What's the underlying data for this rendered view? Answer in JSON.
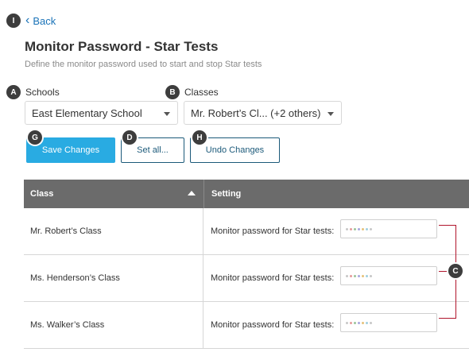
{
  "back": {
    "label": "Back"
  },
  "page": {
    "title": "Monitor Password - Star Tests",
    "subtitle": "Define the monitor password used to start and stop Star tests"
  },
  "markers": {
    "back": "I",
    "schools": "A",
    "classes": "B",
    "save": "G",
    "set_all": "D",
    "undo": "H",
    "passwords": "C"
  },
  "filters": {
    "schools_label": "Schools",
    "schools_value": "East Elementary School",
    "classes_label": "Classes",
    "classes_value": "Mr. Robert’s Cl... (+2 others)"
  },
  "buttons": {
    "save": "Save Changes",
    "set_all": "Set all...",
    "undo": "Undo Changes"
  },
  "table": {
    "headers": {
      "class": "Class",
      "setting": "Setting"
    },
    "sort": "ascending",
    "rows": [
      {
        "class": "Mr. Robert’s Class",
        "setting_label": "Monitor password for Star tests:"
      },
      {
        "class": "Ms. Henderson’s Class",
        "setting_label": "Monitor password for Star tests:"
      },
      {
        "class": "Ms. Walker’s Class",
        "setting_label": "Monitor password for Star tests:"
      }
    ]
  },
  "colors": {
    "primary": "#29abe2",
    "link": "#1a73b8",
    "outline": "#1c5a7a",
    "header_bg": "#6b6b6b",
    "callout": "#b0152c"
  }
}
